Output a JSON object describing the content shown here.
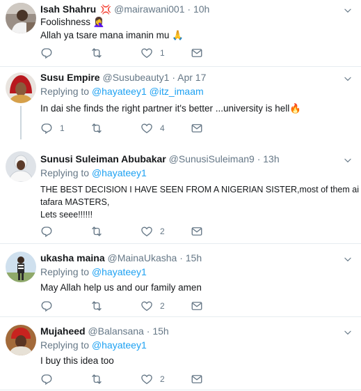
{
  "colors": {
    "link": "#1da1f2",
    "muted": "#657786",
    "heart": "#e0245e"
  },
  "tweets": [
    {
      "name": "Isah Shahru",
      "badge_icon": "anger-symbol-icon",
      "handle": "@mairawani001",
      "dot": "·",
      "time": "10h",
      "lines": [
        "Foolishness 🤦‍♀️",
        "Allah ya tsare mana imanin mu 🙏"
      ],
      "reply_count": "",
      "retweet_count": "",
      "like_count": "1"
    },
    {
      "name": "Susu Empire",
      "handle": "@Susubeauty1",
      "dot": "·",
      "time": "Apr 17",
      "replying_label": "Replying to",
      "mentions": [
        "@hayateey1",
        "@itz_imaam"
      ],
      "lines": [
        "In dai she finds the right partner it's better ...university is hell🔥"
      ],
      "reply_count": "1",
      "retweet_count": "",
      "like_count": "4"
    },
    {
      "name": "Sunusi Suleiman Abubakar",
      "handle": "@SunusiSuleiman9",
      "dot": "·",
      "time": "13h",
      "replying_label": "Replying to",
      "mentions": [
        "@hayateey1"
      ],
      "lines": [
        "THE BEST DECISION I HAVE SEEN FROM A NIGERIAN SISTER,most of them ai sai",
        "tafara MASTERS,",
        "Lets seee!!!!!!"
      ],
      "reply_count": "",
      "retweet_count": "",
      "like_count": "2"
    },
    {
      "name": "ukasha maina",
      "handle": "@MainaUkasha",
      "dot": "·",
      "time": "15h",
      "replying_label": "Replying to",
      "mentions": [
        "@hayateey1"
      ],
      "lines": [
        "May Allah help us and our family amen"
      ],
      "reply_count": "",
      "retweet_count": "",
      "like_count": "2"
    },
    {
      "name": "Mujaheed",
      "handle": "@Balansana",
      "dot": "·",
      "time": "15h",
      "replying_label": "Replying to",
      "mentions": [
        "@hayateey1"
      ],
      "lines": [
        "I buy this idea too"
      ],
      "reply_count": "",
      "retweet_count": "",
      "like_count": "2"
    }
  ]
}
